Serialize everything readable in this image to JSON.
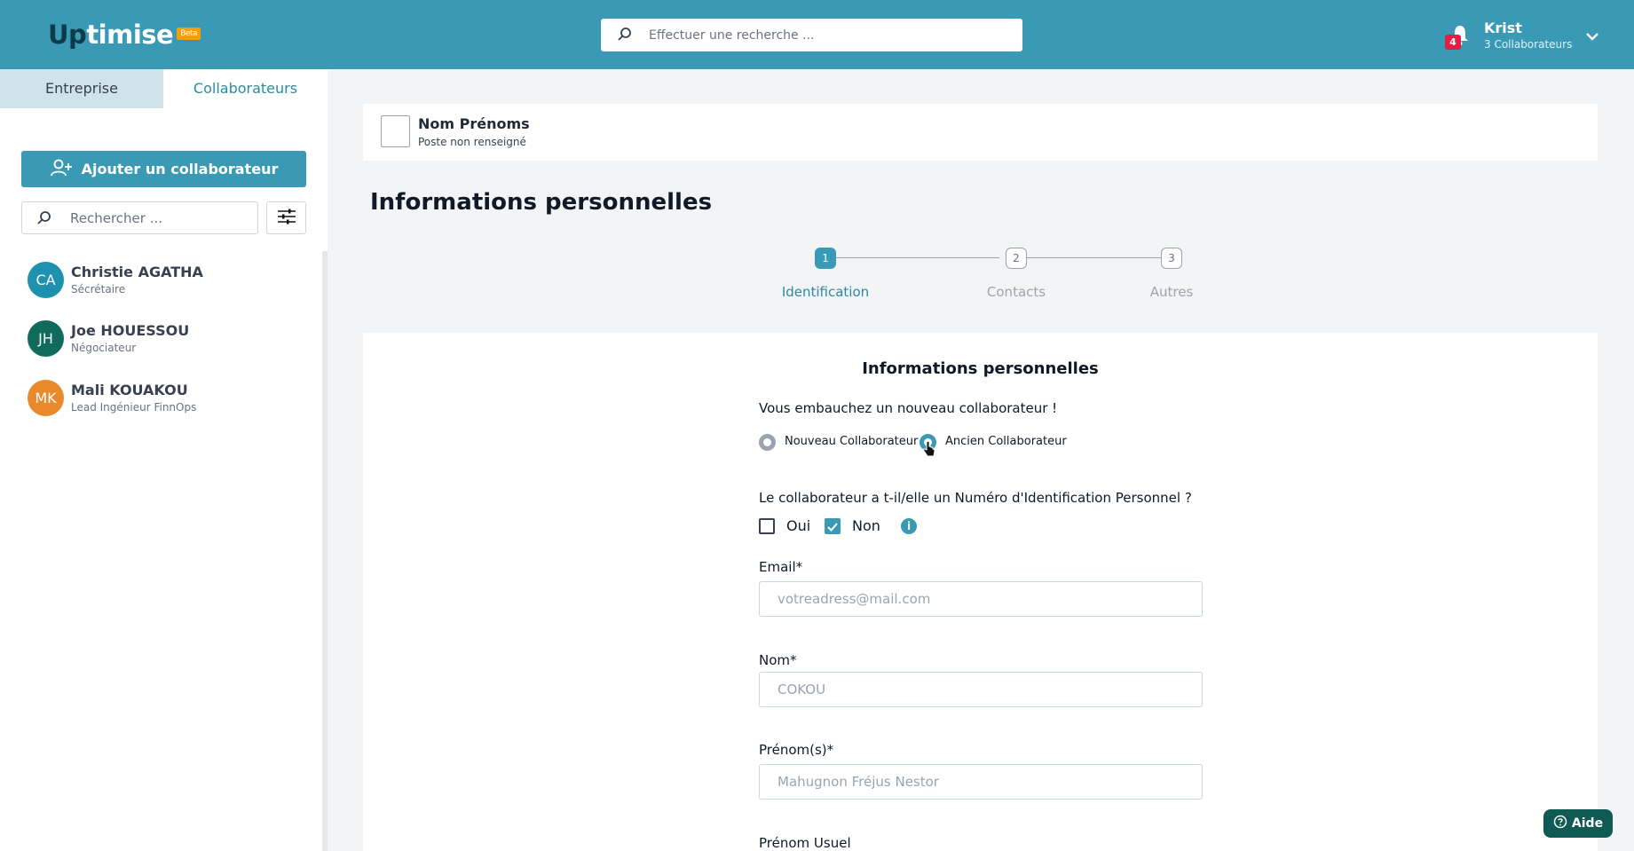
{
  "header": {
    "logo_up": "Up",
    "logo_rest": "timise",
    "logo_badge": "Beta",
    "search_placeholder": "Effectuer une recherche ...",
    "notification_count": "4",
    "user_name": "Krist",
    "user_subtitle": "3 Collaborateurs",
    "accent_color": "#3a9ab5"
  },
  "sidebar": {
    "tabs": [
      {
        "label": "Entreprise",
        "active": false
      },
      {
        "label": "Collaborateurs",
        "active": true
      }
    ],
    "add_button_label": "Ajouter un collaborateur",
    "search_placeholder": "Rechercher ...",
    "collaborators": [
      {
        "initials": "CA",
        "name": "Christie AGATHA",
        "role": "Sécrétaire",
        "color": "#1e90b0"
      },
      {
        "initials": "JH",
        "name": "Joe HOUESSOU",
        "role": "Négociateur",
        "color": "#0f6b5c"
      },
      {
        "initials": "MK",
        "name": "Mali KOUAKOU",
        "role": "Lead Ingénieur FinnOps",
        "color": "#e88a2a"
      }
    ]
  },
  "profile": {
    "name": "Nom Prénoms",
    "role": "Poste non renseigné"
  },
  "page_title": "Informations personnelles",
  "stepper": {
    "steps": [
      {
        "number": "1",
        "label": "Identification",
        "active": true
      },
      {
        "number": "2",
        "label": "Contacts",
        "active": false
      },
      {
        "number": "3",
        "label": "Autres",
        "active": false
      }
    ]
  },
  "form": {
    "title": "Informations personnelles",
    "hire_question": "Vous embauchez un nouveau collaborateur !",
    "radio_new": "Nouveau Collaborateur",
    "radio_old": "Ancien Collaborateur",
    "nip_question": "Le collaborateur a t-il/elle un Numéro d'Identification Personnel ?",
    "checkbox_yes": "Oui",
    "checkbox_no": "Non",
    "checkbox_no_checked": true,
    "info_icon": "i",
    "email_label": "Email*",
    "email_placeholder": "votreadress@mail.com",
    "nom_label": "Nom*",
    "nom_placeholder": "COKOU",
    "prenom_label": "Prénom(s)*",
    "prenom_placeholder": "Mahugnon Fréjus Nestor",
    "prenom_usuel_label": "Prénom Usuel"
  },
  "help_button_label": "Aide"
}
